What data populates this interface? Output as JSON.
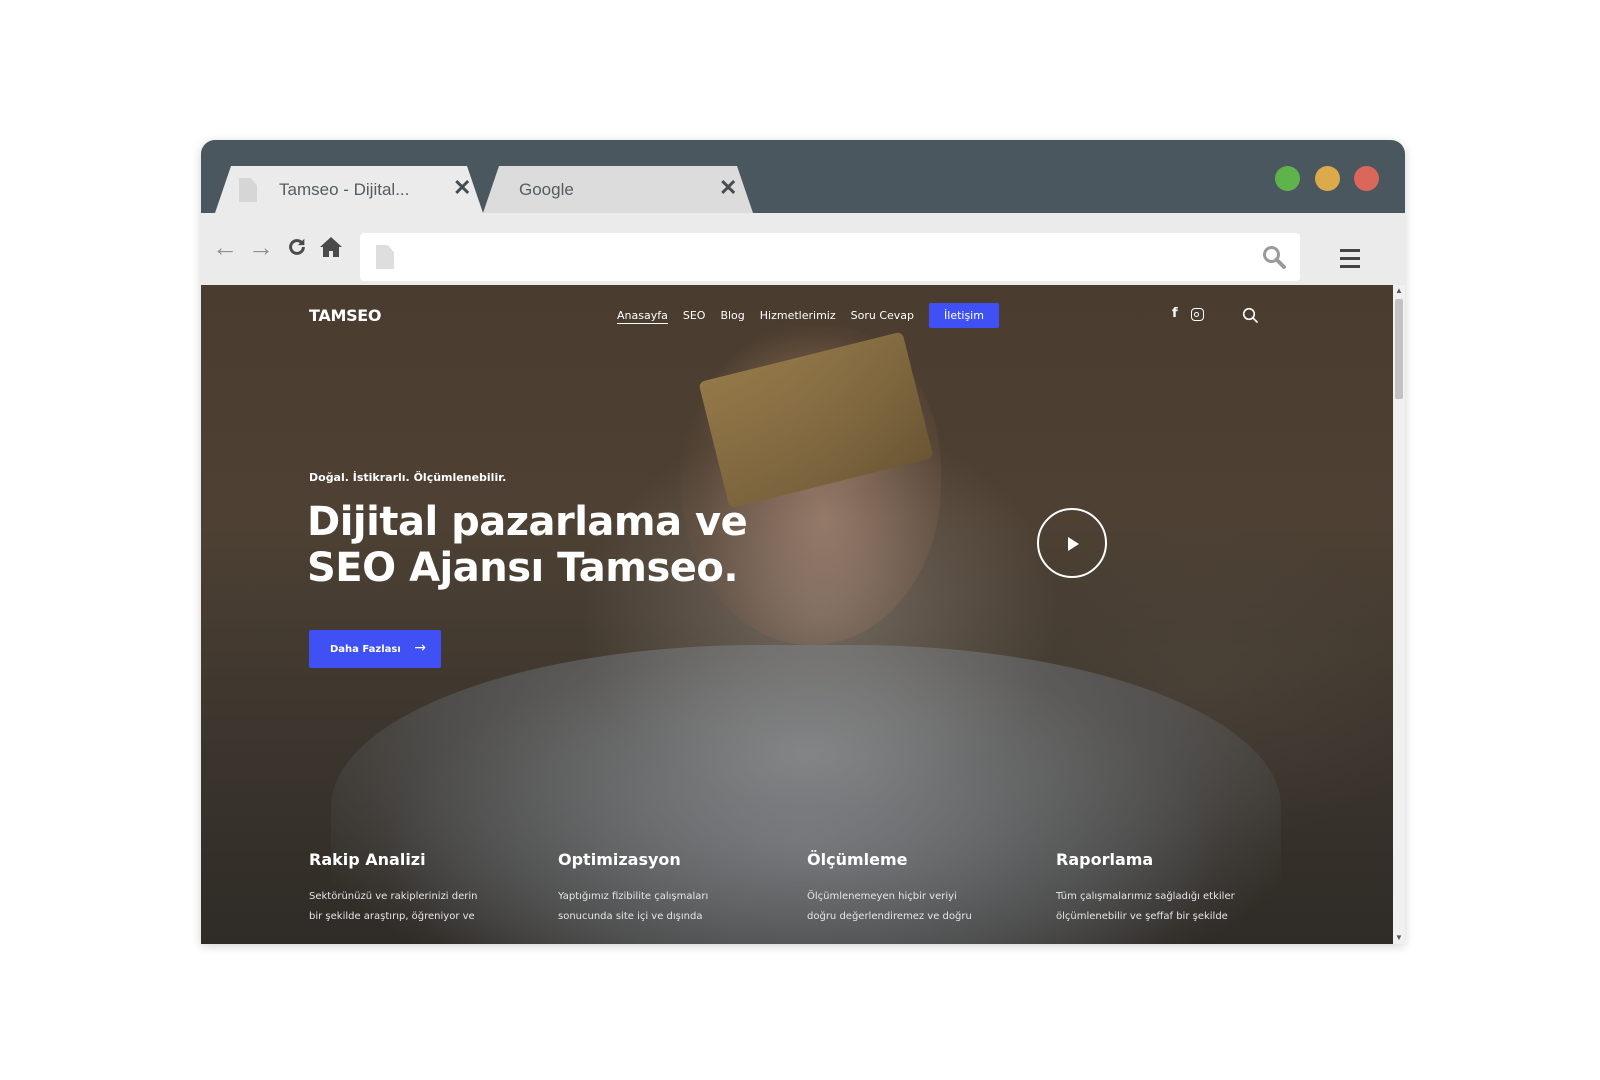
{
  "browser": {
    "tabs": [
      {
        "title": "Tamseo - Dijital...",
        "close": "✕",
        "active": true
      },
      {
        "title": "Google",
        "close": "✕",
        "active": false
      }
    ],
    "window_buttons": {
      "green": "#5fb34d",
      "yellow": "#dcaa4a",
      "red": "#da6759"
    },
    "toolbar": {
      "back_icon": "←",
      "forward_icon": "→",
      "reload_icon": "↻",
      "home_icon": "⌂",
      "address_value": "",
      "menu_icon": "hamburger-icon"
    }
  },
  "site": {
    "logo": "TAMSEO",
    "menu": [
      "Anasayfa",
      "SEO",
      "Blog",
      "Hizmetlerimiz",
      "Soru Cevap"
    ],
    "menu_active": "Anasayfa",
    "menu_cta": "İletişim",
    "accent": "#3f51f5",
    "hero": {
      "eyebrow": "Doğal. İstikrarlı. Ölçümlenebilir.",
      "title_line1": "Dijital pazarlama ve",
      "title_line2": "SEO Ajansı Tamseo.",
      "button": "Daha Fazlası",
      "button_arrow": "→"
    },
    "features": [
      {
        "title": "Rakip Analizi",
        "line1": "Sektörünüzü ve rakiplerinizi derin",
        "line2": "bir şekilde araştırıp, öğreniyor ve"
      },
      {
        "title": "Optimizasyon",
        "line1": "Yaptığımız fizibilite çalışmaları",
        "line2": "sonucunda site içi ve dışında"
      },
      {
        "title": "Ölçümleme",
        "line1": "Ölçümlenemeyen hiçbir veriyi",
        "line2": "doğru değerlendiremez ve doğru"
      },
      {
        "title": "Raporlama",
        "line1": "Tüm çalışmalarımız sağladığı etkiler",
        "line2": "ölçümlenebilir ve şeffaf bir şekilde"
      }
    ]
  }
}
